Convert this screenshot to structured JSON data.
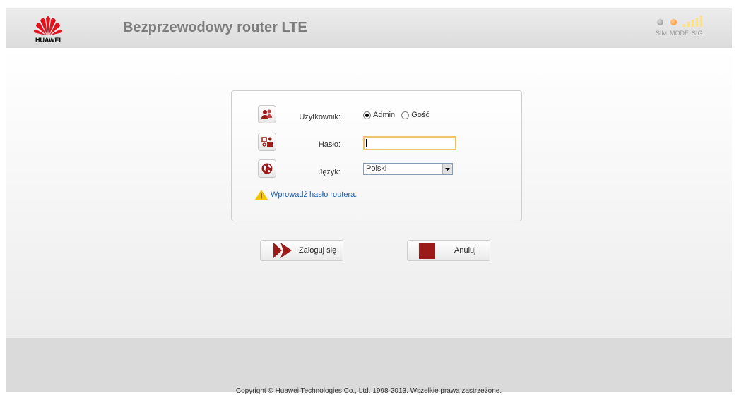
{
  "header": {
    "logo_text": "HUAWEI",
    "title": "Bezprzewodowy router LTE",
    "status": {
      "sim_label": "SIM",
      "mode_label": "MODE",
      "sig_label": "SIG",
      "sim_color": "#9a9a9a",
      "mode_color": "#ff8a1c",
      "signal_color": "#ffe27a",
      "signal_bars": 5
    }
  },
  "login": {
    "user_label": "Użytkownik:",
    "user_options": [
      {
        "label": "Admin",
        "checked": true
      },
      {
        "label": "Gość",
        "checked": false
      }
    ],
    "password_label": "Hasło:",
    "password_value": "",
    "language_label": "Język:",
    "language_selected": "Polski",
    "warning": "Wprowadź hasło routera."
  },
  "buttons": {
    "login": "Zaloguj się",
    "cancel": "Anuluj"
  },
  "footer": {
    "copyright": "Copyright © Huawei Technologies Co., Ltd. 1998-2013. Wszelkie prawa zastrzeżone."
  },
  "colors": {
    "accent_red": "#9b1b1b",
    "title_gray": "#7d7d7d",
    "link_blue": "#1a5fb4"
  }
}
